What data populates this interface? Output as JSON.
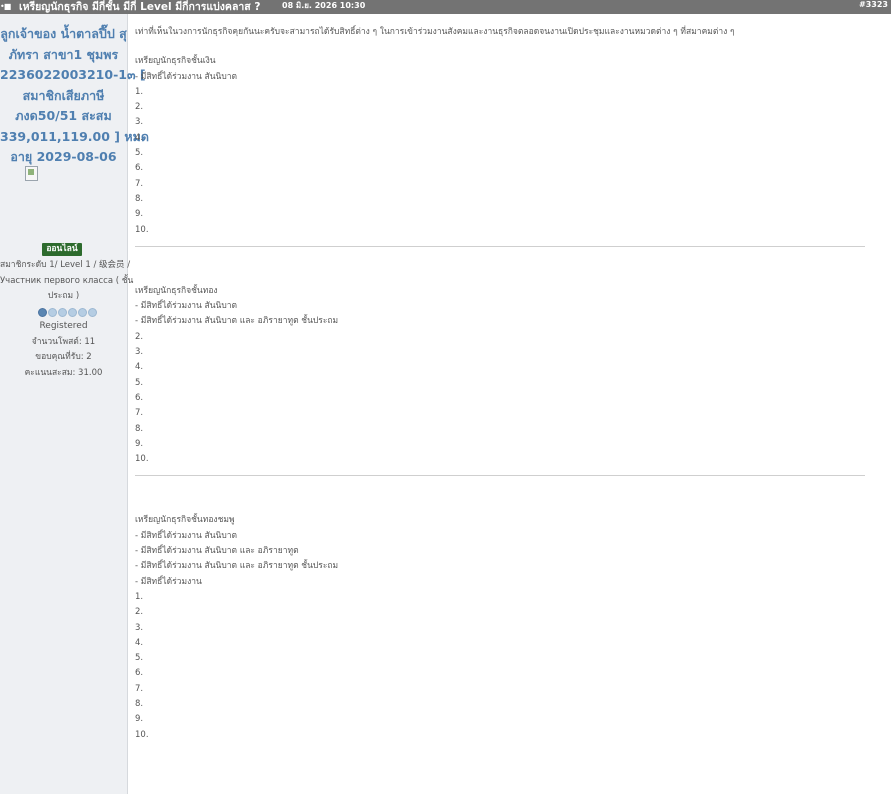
{
  "header": {
    "bullets": "•■",
    "title": "เหรียญนักธุรกิจ มีกี่ชั้น มีกี่ Level มีกี่การแบ่งคลาส ?",
    "date": "08 มิ.ย. 2026 10:30",
    "post_number": "#3323"
  },
  "profile": {
    "name_lines": [
      "ลูกเจ้าของ น้ำตาลปี๊ป สุ",
      "ภัทรา สาขา1 ชุมพร",
      "2236022003210-1๓ [",
      "สมาชิกเสียภาษี",
      "ภงด50/51 สะสม",
      "339,011,119.00 ] หมด",
      "อายุ 2029-08-06"
    ],
    "online_badge": "ออนไลน์",
    "rank_lines": [
      "สมาชิกระดับ 1/ Level 1 / 级会员 /",
      "Участник первого класса ( ชั้น",
      "ประถม )"
    ],
    "rank_level": 1,
    "rank_max": 6,
    "status": "Registered",
    "posts": "จำนวนโพสต์: 11",
    "thanks": "ขอบคุณที่รับ: 2",
    "points": "คะแนนสะสม: 31.00"
  },
  "post": {
    "intro": "เท่าที่เห็นในวงการนักธุรกิจคุยกันนะครับจะสามารถได้รับสิทธิ์ต่าง ๆ ในการเข้าร่วมงานสังคมและงานธุรกิจตลอดจนงานเปิดประชุมและงานหมวดต่าง ๆ ที่สมาคมต่าง ๆ",
    "section1": {
      "title": "เหรียญนักธุรกิจชั้นเงิน",
      "lines": [
        "- มีสิทธิ์ได้ร่วมงาน สันนิบาต"
      ],
      "items": [
        "1.",
        "2.",
        "3.",
        "4.",
        "5.",
        "6.",
        "7.",
        "8.",
        "9.",
        "10."
      ]
    },
    "section2": {
      "title": "เหรียญนักธุรกิจชั้นทอง",
      "lines": [
        "- มีสิทธิ์ได้ร่วมงาน สันนิบาต",
        "- มีสิทธิ์ได้ร่วมงาน สันนิบาต และ อภิรายาทูต ชั้นประถม"
      ],
      "items": [
        "2.",
        "3.",
        "4.",
        "5.",
        "6.",
        "7.",
        "8.",
        "9.",
        "10."
      ]
    },
    "section3": {
      "title": "เหรียญนักธุรกิจชั้นทองชมพู",
      "lines": [
        "- มีสิทธิ์ได้ร่วมงาน สันนิบาต",
        "- มีสิทธิ์ได้ร่วมงาน สันนิบาต และ อภิรายาทูต",
        "- มีสิทธิ์ได้ร่วมงาน สันนิบาต และ อภิรายาทูต ชั้นประถม",
        "- มีสิทธิ์ได้ร่วมงาน"
      ],
      "items": [
        "1.",
        "2.",
        "3.",
        "4.",
        "5.",
        "6.",
        "7.",
        "8.",
        "9.",
        "10."
      ]
    }
  },
  "colors": {
    "header_bg": "#737373",
    "username": "#4f7fb0",
    "online_badge": "#2d6b2d",
    "sidebar_bg": "#eef0f3"
  }
}
